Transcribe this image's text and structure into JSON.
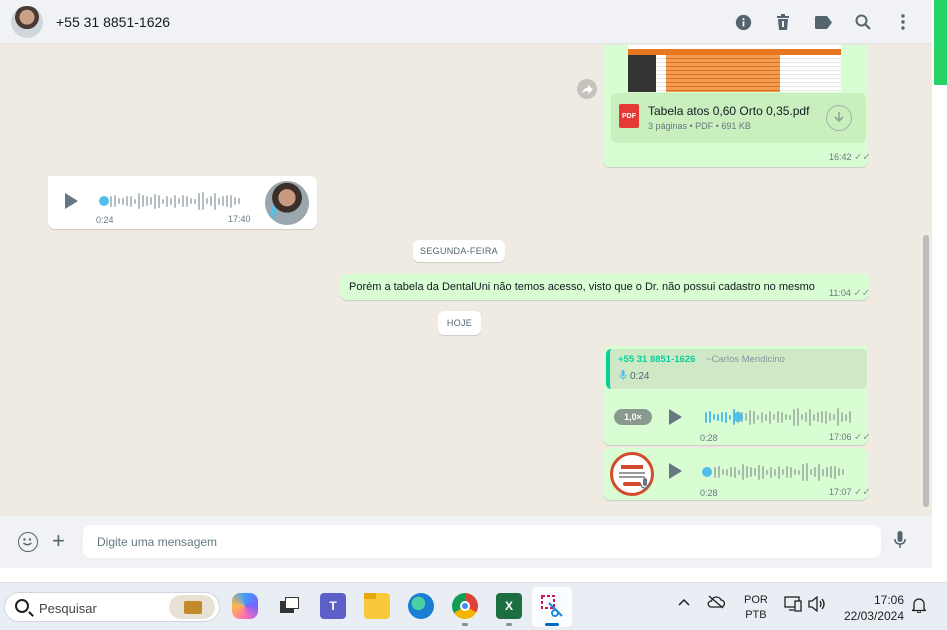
{
  "header": {
    "contact_name": "+55 31 8851-1626",
    "icons": [
      "info-icon",
      "trash-icon",
      "label-icon",
      "search-icon",
      "more-icon"
    ]
  },
  "messages": {
    "pdf": {
      "file_name": "Tabela atos 0,60 Orto 0,35.pdf",
      "meta": "3 páginas • PDF • 691 KB",
      "time": "16:42",
      "icon_label": "PDF"
    },
    "voice_in": {
      "elapsed": "0:24",
      "time": "17:40"
    },
    "date_1": "SEGUNDA-FEIRA",
    "text_out": {
      "text": "Porém a tabela da DentalUni não temos acesso, visto que o Dr. não possui cadastro no mesmo",
      "time": "11:04"
    },
    "date_2": "HOJE",
    "voice_reply": {
      "quoted_number": "+55 31 8851-1626",
      "quoted_alias": "~Carlos Mendicino",
      "quoted_duration": "0:24",
      "speed": "1,0×",
      "elapsed": "0:28",
      "time": "17:06"
    },
    "voice_out_2": {
      "elapsed": "0:28",
      "time": "17:07"
    }
  },
  "composer": {
    "placeholder": "Digite uma mensagem"
  },
  "taskbar": {
    "search_placeholder": "Pesquisar",
    "language": "POR",
    "layout": "PTB",
    "time": "17:06",
    "date": "22/03/2024"
  },
  "colors": {
    "outgoing_bubble": "#d9fdd3",
    "incoming_bubble": "#ffffff",
    "chat_background": "#efeae2",
    "accent_green": "#25d366",
    "play_dot": "#53bdeb"
  }
}
